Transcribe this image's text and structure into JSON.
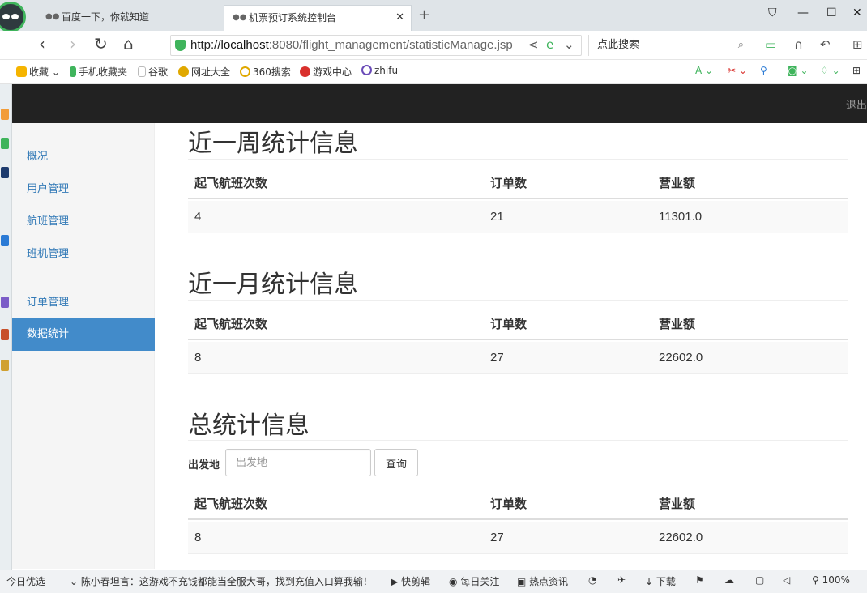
{
  "browser": {
    "tabs": [
      {
        "label": "百度一下，你就知道"
      },
      {
        "label": "机票预订系统控制台"
      }
    ],
    "url_prefix": "http://",
    "url_host": "localhost",
    "url_path": ":8080/flight_management/statisticManage.jsp",
    "search_placeholder": "点此搜索",
    "bookmarks": [
      {
        "label": "收藏",
        "color": "#f5b400"
      },
      {
        "label": "手机收藏夹",
        "color": "#3fb45c"
      },
      {
        "label": "谷歌",
        "color": "#bbbbbb"
      },
      {
        "label": "网址大全",
        "color": "#e0a800"
      },
      {
        "label": "360搜索",
        "color": "#3fb45c"
      },
      {
        "label": "游戏中心",
        "color": "#d9302c"
      },
      {
        "label": "zhifu",
        "color": "#6a4bb8"
      }
    ]
  },
  "app": {
    "logout": "退出",
    "nav": [
      {
        "label": "概况"
      },
      {
        "label": "用户管理"
      },
      {
        "label": "航班管理"
      },
      {
        "label": "班机管理"
      },
      {
        "label": "订单管理"
      },
      {
        "label": "数据统计"
      }
    ],
    "active_nav": "数据统计",
    "columns": [
      "起飞航班次数",
      "订单数",
      "营业额"
    ],
    "sections": {
      "week": {
        "title": "近一周统计信息",
        "row": [
          "4",
          "21",
          "11301.0"
        ]
      },
      "month": {
        "title": "近一月统计信息",
        "row": [
          "8",
          "27",
          "22602.0"
        ]
      },
      "total": {
        "title": "总统计信息",
        "row": [
          "8",
          "27",
          "22602.0"
        ]
      }
    },
    "filter": {
      "label": "出发地",
      "placeholder": "出发地",
      "button": "查询"
    }
  },
  "statusbar": {
    "items": [
      "今日优选",
      "陈小春坦言：这游戏不充钱都能当全服大哥，找到充值入口算我输！",
      "快剪辑",
      "每日关注",
      "热点资讯",
      "下载",
      "100%"
    ]
  },
  "colors": {
    "header_bg": "#222222",
    "sidebar_bg": "#f5f5f5",
    "active_nav_bg": "#428bca",
    "link": "#337ab7"
  }
}
